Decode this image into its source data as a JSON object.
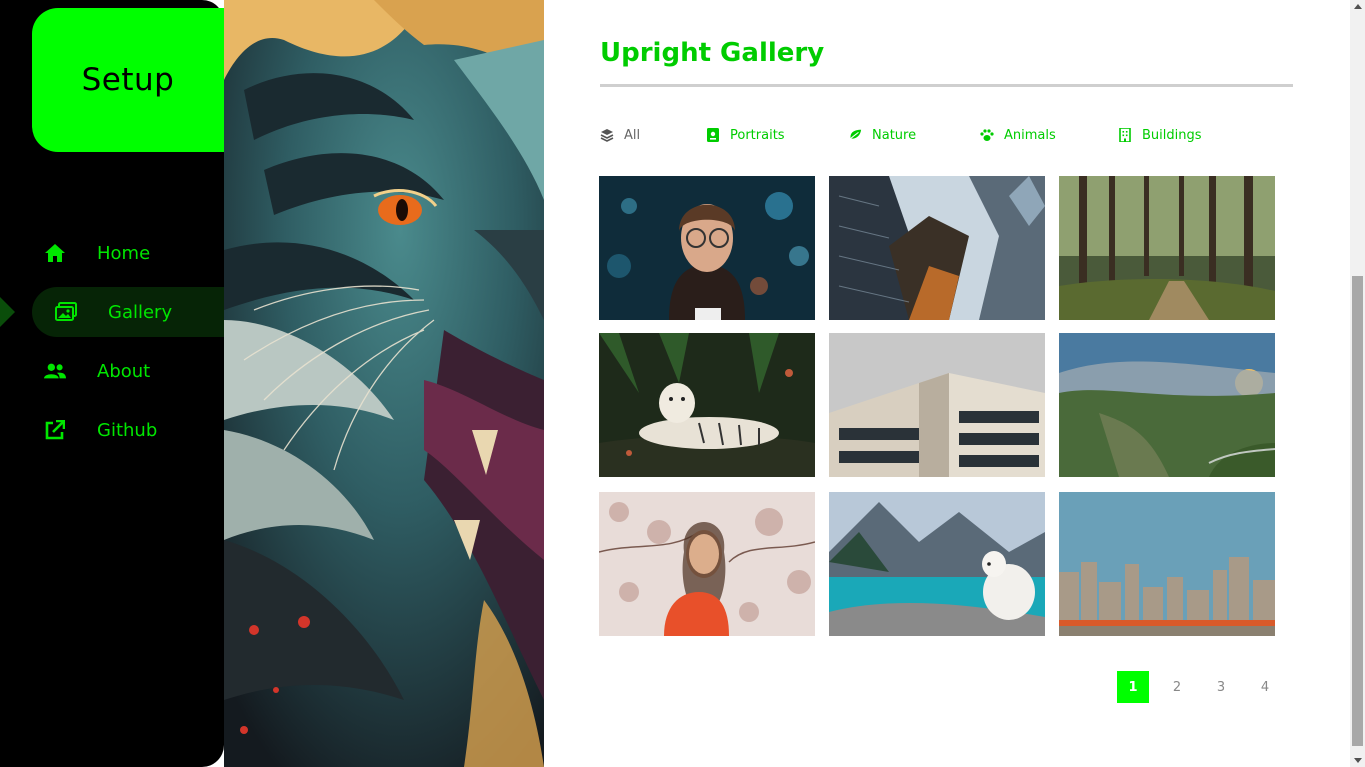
{
  "brand": {
    "title": "Setup",
    "color": "#00ff00"
  },
  "sidebar": {
    "items": [
      {
        "label": "Home",
        "icon": "home-icon"
      },
      {
        "label": "Gallery",
        "icon": "images-icon",
        "active": true
      },
      {
        "label": "About",
        "icon": "users-icon"
      },
      {
        "label": "Github",
        "icon": "external-link-icon"
      }
    ]
  },
  "gallery": {
    "title": "Upright Gallery",
    "filters": [
      {
        "label": "All",
        "icon": "layers-icon"
      },
      {
        "label": "Portraits",
        "icon": "portrait-icon"
      },
      {
        "label": "Nature",
        "icon": "leaf-icon"
      },
      {
        "label": "Animals",
        "icon": "paw-icon"
      },
      {
        "label": "Buildings",
        "icon": "building-icon"
      }
    ],
    "photos": [
      "portrait-woman-glasses",
      "skyscrapers-looking-up",
      "forest-path",
      "white-tiger",
      "modern-building",
      "mountain-valley-sunset",
      "woman-cherry-blossom",
      "dog-by-lake",
      "city-skyline"
    ]
  },
  "pagination": {
    "pages": [
      "1",
      "2",
      "3",
      "4"
    ],
    "current": "1"
  }
}
